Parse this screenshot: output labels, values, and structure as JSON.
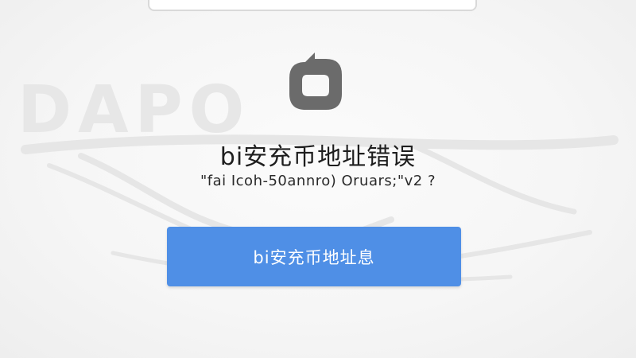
{
  "watermark": {
    "text": "DAPO"
  },
  "logo": {
    "icon": "app-logo-icon",
    "color": "#6b6b6b"
  },
  "error": {
    "title": "bi安充币地址错误",
    "subtitle": "\"fai Icoh-50annro) Oruars;\"v2 ?"
  },
  "action_button": {
    "label": "bi安充币地址息",
    "color": "#4f8fe6"
  }
}
